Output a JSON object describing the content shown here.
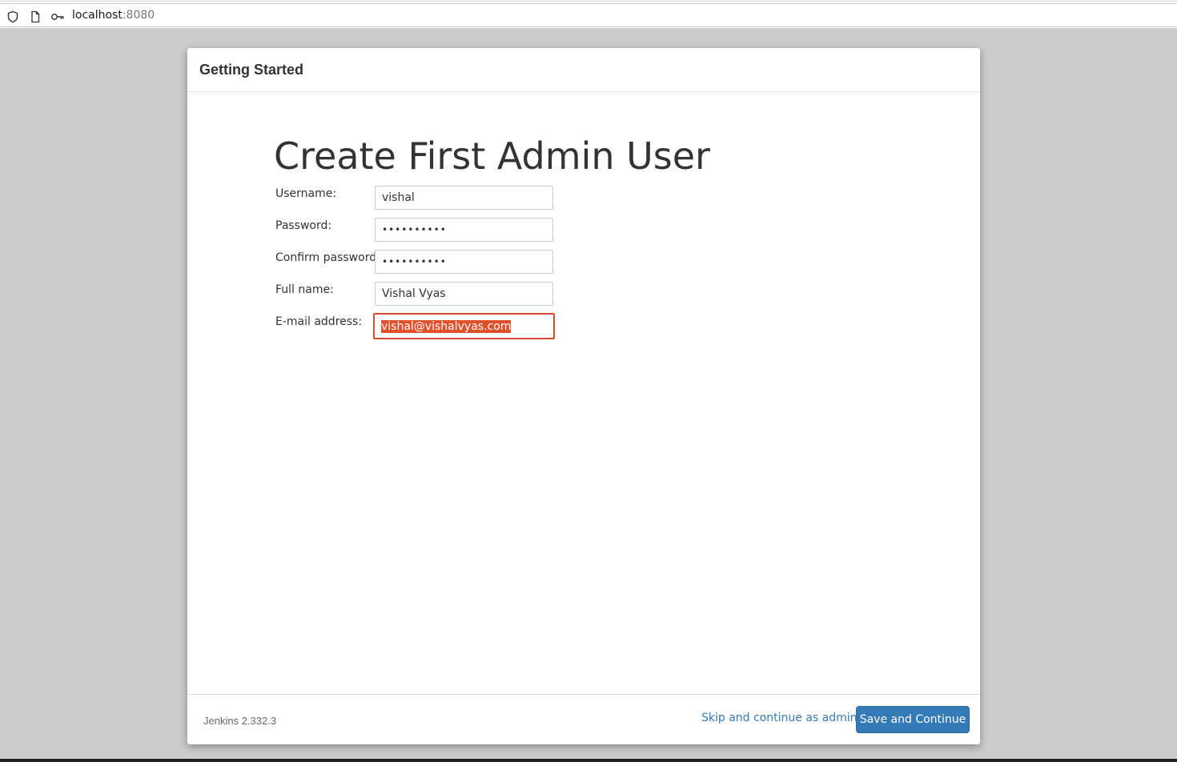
{
  "browser": {
    "url_host": "localhost",
    "url_port": ":8080",
    "icons": [
      "shield-icon",
      "page-icon",
      "key-icon"
    ]
  },
  "modal": {
    "title": "Getting Started",
    "heading": "Create First Admin User",
    "fields": [
      {
        "label": "Username:",
        "value": "vishal"
      },
      {
        "label": "Password:",
        "value": "••••••••••"
      },
      {
        "label": "Confirm password:",
        "value": "••••••••••"
      },
      {
        "label": "Full name:",
        "value": "Vishal Vyas"
      },
      {
        "label": "E-mail address:",
        "value": "vishal@vishalvyas.com"
      }
    ]
  },
  "footer": {
    "version": "Jenkins 2.332.3",
    "skip_label": "Skip and continue as admin",
    "save_label": "Save and Continue"
  },
  "colors": {
    "primary": "#337ab7",
    "focus_border": "#d24f31",
    "selection": "#e0502a"
  }
}
